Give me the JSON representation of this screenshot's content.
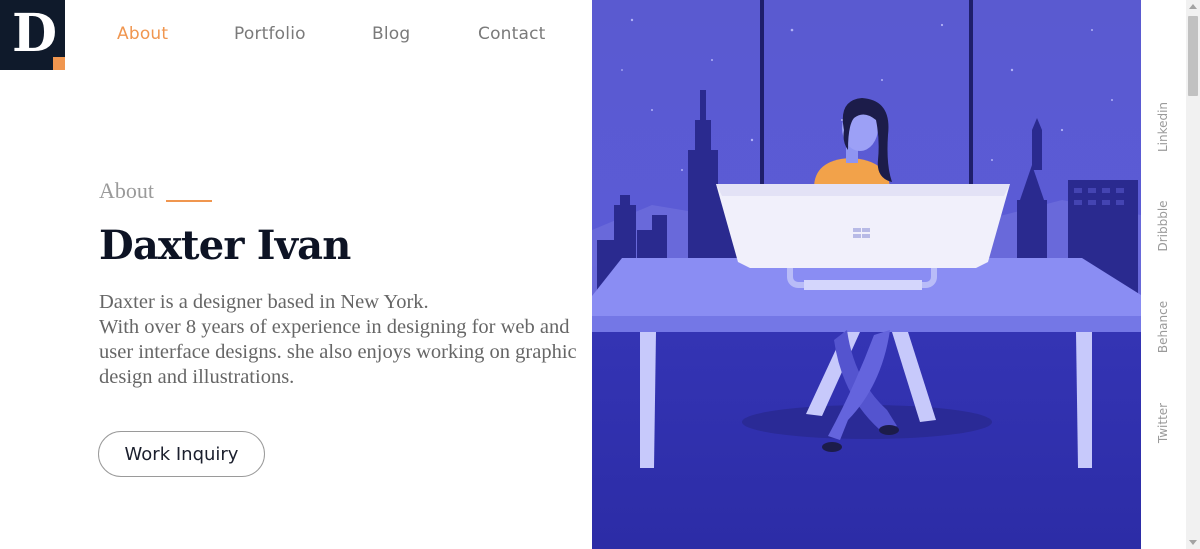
{
  "logo": {
    "letter": "D"
  },
  "nav": {
    "items": [
      {
        "label": "About",
        "active": true
      },
      {
        "label": "Portfolio",
        "active": false
      },
      {
        "label": "Blog",
        "active": false
      },
      {
        "label": "Contact",
        "active": false
      }
    ]
  },
  "hero": {
    "section_label": "About",
    "name": "Daxter Ivan",
    "bio": [
      "Daxter is a designer based in New York.",
      "With over 8 years of experience in designing for web and user interface designs. she also enjoys working on graphic design and illustrations."
    ],
    "cta_label": "Work Inquiry"
  },
  "social": {
    "links": [
      "Linkedin",
      "Dribbble",
      "Behance",
      "Twitter"
    ]
  },
  "colors": {
    "accent": "#f0964f",
    "dark": "#0f1a2b",
    "text_muted": "#666666",
    "illustration_bg": "#3b3bb0"
  },
  "illustration": {
    "icon": "woman-at-desk-city-night-illustration"
  }
}
